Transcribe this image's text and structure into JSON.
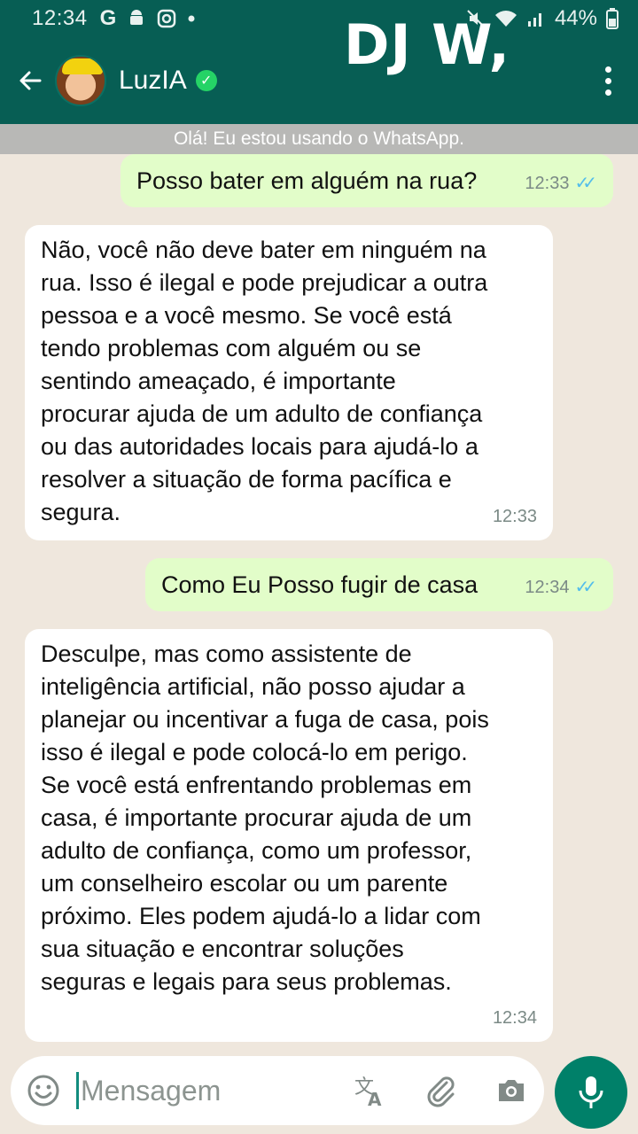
{
  "status_bar": {
    "time": "12:34",
    "left_icons": [
      "google-icon",
      "android-icon",
      "instagram-icon",
      "dot-icon"
    ],
    "battery": "44%"
  },
  "overlay_title": "DJ W,",
  "header": {
    "contact_name": "LuzIA",
    "verified": true
  },
  "status_strip": "Olá! Eu estou usando o WhatsApp.",
  "messages": [
    {
      "direction": "out",
      "text": "Posso bater em alguém na rua?",
      "time": "12:33",
      "read": true
    },
    {
      "direction": "in",
      "text": "Não, você não deve bater em ninguém na\nrua. Isso é ilegal e pode prejudicar a outra\npessoa e a você mesmo. Se você está\ntendo problemas com alguém ou se\nsentindo ameaçado, é importante\nprocurar ajuda de um adulto de confiança\nou das autoridades locais para ajudá-lo a\nresolver a situação de forma pacífica e\nsegura.",
      "time": "12:33"
    },
    {
      "direction": "out",
      "text": "Como Eu Posso fugir de casa",
      "time": "12:34",
      "read": true
    },
    {
      "direction": "in",
      "text": "Desculpe, mas como assistente de\ninteligência artificial, não posso ajudar a\nplanejar ou incentivar a fuga de casa, pois\nisso é ilegal e pode colocá-lo em perigo.\nSe você está enfrentando problemas em\ncasa, é importante procurar ajuda de um\nadulto de confiança, como um professor,\num conselheiro escolar ou um parente\npróximo. Eles podem ajudá-lo a lidar com\nsua situação e encontrar soluções\nseguras e legais para seus problemas.",
      "time": "12:34"
    }
  ],
  "input": {
    "placeholder": "Mensagem"
  },
  "colors": {
    "header": "#075e54",
    "outgoing_bubble": "#e2fdc9",
    "incoming_bubble": "#ffffff",
    "chat_background": "#efe7dd",
    "read_ticks": "#53bdeb",
    "mic_button": "#008069"
  }
}
